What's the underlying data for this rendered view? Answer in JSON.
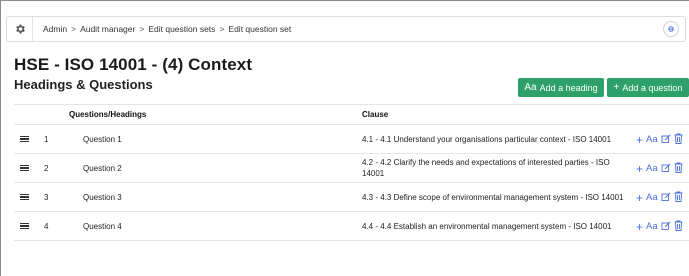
{
  "breadcrumb": [
    "Admin",
    "Audit manager",
    "Edit question sets",
    "Edit question set"
  ],
  "breadcrumb_separator": ">",
  "page_title": "HSE - ISO 14001 - (4) Context",
  "section_title": "Headings & Questions",
  "buttons": {
    "add_heading_glyph": "Aa",
    "add_heading": "Add a heading",
    "add_question_glyph": "+",
    "add_question": "Add a question"
  },
  "table": {
    "headers": {
      "questions": "Questions/Headings",
      "clause": "Clause"
    },
    "rows": [
      {
        "num": "1",
        "question": "Question 1",
        "clause": "4.1 - 4.1 Understand your organisations particular context - ISO 14001"
      },
      {
        "num": "2",
        "question": "Question 2",
        "clause": "4.2 - 4.2 Clarify the needs and expectations of interested parties - ISO 14001"
      },
      {
        "num": "3",
        "question": "Question 3",
        "clause": "4.3 - 4.3 Define scope of environmental management system - ISO 14001"
      },
      {
        "num": "4",
        "question": "Question 4",
        "clause": "4.4 - 4.4 Establish an environmental management system - ISO 14001"
      }
    ],
    "row_actions": {
      "add": "+",
      "heading": "Aa"
    }
  },
  "colors": {
    "accent_green": "#2ea16a",
    "action_blue": "#4d6ce0"
  },
  "icons": [
    "gear-icon",
    "chevron-circle-icon",
    "drag-handle-icon",
    "plus-icon",
    "edit-icon",
    "trash-icon"
  ]
}
